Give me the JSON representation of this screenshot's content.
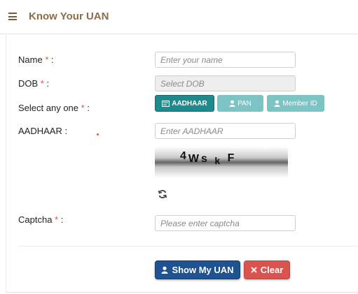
{
  "header": {
    "title": "Know Your UAN",
    "menu_icon": "hamburger-icon"
  },
  "form": {
    "name": {
      "label": "Name",
      "required": "*",
      "colon": " :",
      "placeholder": "Enter your name"
    },
    "dob": {
      "label": "DOB",
      "required": "*",
      "colon": " :",
      "placeholder": "Select DOB"
    },
    "select_any": {
      "label": "Select any one",
      "required": "*",
      "colon": " :",
      "options": [
        {
          "label": "AADHAAR",
          "icon": "id-card-icon",
          "selected": true
        },
        {
          "label": "PAN",
          "icon": "user-icon",
          "selected": false
        },
        {
          "label": "Member ID",
          "icon": "user-icon",
          "selected": false
        }
      ]
    },
    "aadhaar": {
      "label": "AADHAAR :",
      "placeholder": "Enter AADHAAR"
    },
    "captcha_image": {
      "text": "4Ws k F"
    },
    "refresh_icon": "refresh-icon",
    "captcha": {
      "label": "Captcha",
      "required": "*",
      "colon": " :",
      "placeholder": "Please enter captcha"
    }
  },
  "buttons": {
    "show_uan": {
      "label": "Show My UAN",
      "icon": "user-icon",
      "color": "#1f5291"
    },
    "clear": {
      "label": "Clear",
      "icon": "close-icon",
      "color": "#d9534f"
    }
  },
  "colors": {
    "accent": "#8a6d4b",
    "teal": "#1f8a8e",
    "required": "#d9534f"
  }
}
